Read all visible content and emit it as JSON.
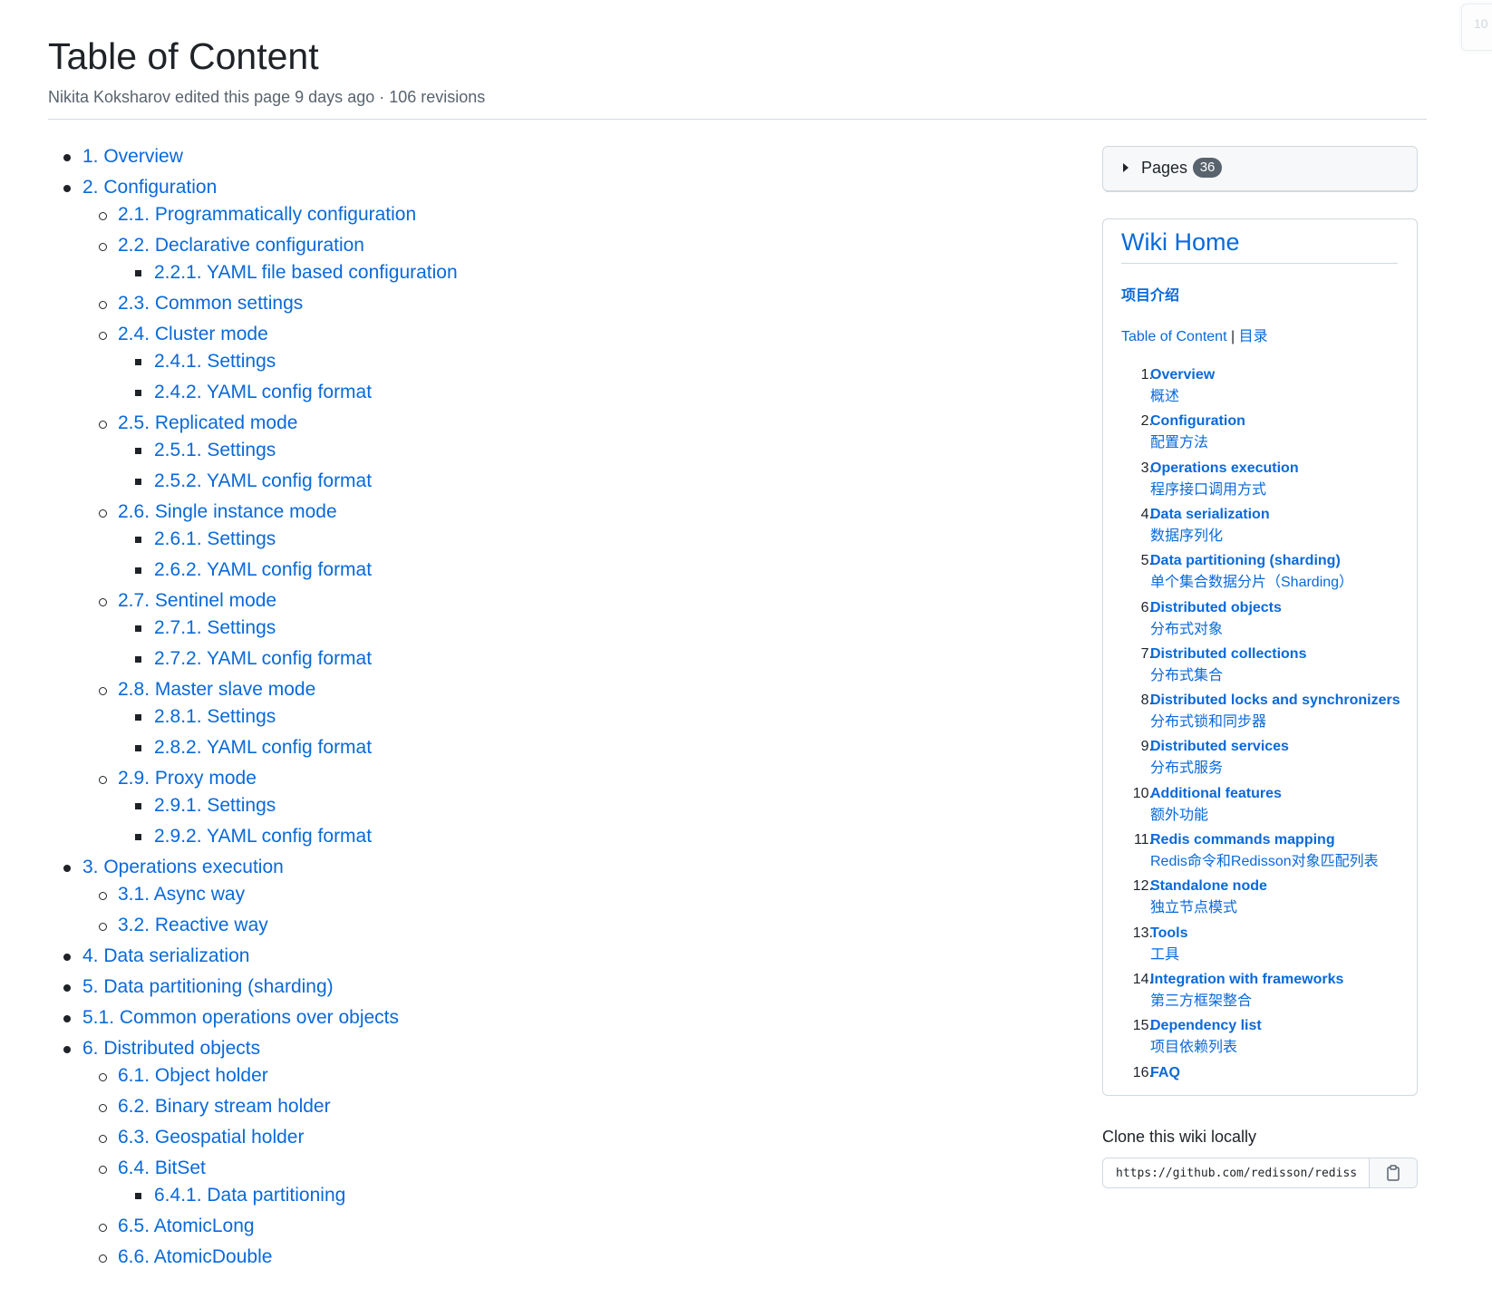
{
  "corner": {
    "text": "10"
  },
  "header": {
    "title": "Table of Content",
    "meta": "Nikita Koksharov edited this page 9 days ago · 106 revisions"
  },
  "toc": [
    {
      "level": 1,
      "label": "1. Overview"
    },
    {
      "level": 1,
      "label": "2. Configuration"
    },
    {
      "level": 2,
      "label": "2.1. Programmatically configuration"
    },
    {
      "level": 2,
      "label": "2.2. Declarative configuration"
    },
    {
      "level": 3,
      "label": "2.2.1. YAML file based configuration"
    },
    {
      "level": 2,
      "label": "2.3. Common settings"
    },
    {
      "level": 2,
      "label": "2.4. Cluster mode"
    },
    {
      "level": 3,
      "label": "2.4.1. Settings"
    },
    {
      "level": 3,
      "label": "2.4.2. YAML config format"
    },
    {
      "level": 2,
      "label": "2.5. Replicated mode"
    },
    {
      "level": 3,
      "label": "2.5.1. Settings"
    },
    {
      "level": 3,
      "label": "2.5.2. YAML config format"
    },
    {
      "level": 2,
      "label": "2.6. Single instance mode"
    },
    {
      "level": 3,
      "label": "2.6.1. Settings"
    },
    {
      "level": 3,
      "label": "2.6.2. YAML config format"
    },
    {
      "level": 2,
      "label": "2.7. Sentinel mode"
    },
    {
      "level": 3,
      "label": "2.7.1. Settings"
    },
    {
      "level": 3,
      "label": "2.7.2. YAML config format"
    },
    {
      "level": 2,
      "label": "2.8. Master slave mode"
    },
    {
      "level": 3,
      "label": "2.8.1. Settings"
    },
    {
      "level": 3,
      "label": "2.8.2. YAML config format"
    },
    {
      "level": 2,
      "label": "2.9. Proxy mode"
    },
    {
      "level": 3,
      "label": "2.9.1. Settings"
    },
    {
      "level": 3,
      "label": "2.9.2. YAML config format"
    },
    {
      "level": 1,
      "label": "3. Operations execution"
    },
    {
      "level": 2,
      "label": "3.1. Async way"
    },
    {
      "level": 2,
      "label": "3.2. Reactive way"
    },
    {
      "level": 1,
      "label": "4. Data serialization"
    },
    {
      "level": 1,
      "label": "5. Data partitioning (sharding)"
    },
    {
      "level": 1,
      "label": "5.1. Common operations over objects"
    },
    {
      "level": 1,
      "label": "6. Distributed objects"
    },
    {
      "level": 2,
      "label": "6.1. Object holder"
    },
    {
      "level": 2,
      "label": "6.2. Binary stream holder"
    },
    {
      "level": 2,
      "label": "6.3. Geospatial holder"
    },
    {
      "level": 2,
      "label": "6.4. BitSet"
    },
    {
      "level": 3,
      "label": "6.4.1. Data partitioning"
    },
    {
      "level": 2,
      "label": "6.5. AtomicLong"
    },
    {
      "level": 2,
      "label": "6.6. AtomicDouble"
    }
  ],
  "sidebar": {
    "pages_label": "Pages",
    "pages_count": "36",
    "wiki_home": "Wiki Home",
    "intro": "项目介绍",
    "toc_link": "Table of Content",
    "toc_separator": " | ",
    "toc_link_zh": "目录",
    "items": [
      {
        "num": "1.",
        "en": "Overview",
        "zh": "概述"
      },
      {
        "num": "2.",
        "en": "Configuration",
        "zh": "配置方法"
      },
      {
        "num": "3.",
        "en": "Operations execution",
        "zh": "程序接口调用方式"
      },
      {
        "num": "4.",
        "en": "Data serialization",
        "zh": "数据序列化"
      },
      {
        "num": "5.",
        "en": "Data partitioning (sharding)",
        "zh": "单个集合数据分片（Sharding）"
      },
      {
        "num": "6.",
        "en": "Distributed objects",
        "zh": "分布式对象"
      },
      {
        "num": "7.",
        "en": "Distributed collections",
        "zh": "分布式集合"
      },
      {
        "num": "8.",
        "en": "Distributed locks and synchronizers",
        "zh": "分布式锁和同步器"
      },
      {
        "num": "9.",
        "en": "Distributed services",
        "zh": "分布式服务"
      },
      {
        "num": "10.",
        "en": "Additional features",
        "zh": "额外功能"
      },
      {
        "num": "11.",
        "en": "Redis commands mapping",
        "zh": "Redis命令和Redisson对象匹配列表"
      },
      {
        "num": "12.",
        "en": "Standalone node",
        "zh": "独立节点模式"
      },
      {
        "num": "13.",
        "en": "Tools",
        "zh": "工具"
      },
      {
        "num": "14.",
        "en": "Integration with frameworks",
        "zh": "第三方框架整合"
      },
      {
        "num": "15.",
        "en": "Dependency list",
        "zh": "项目依赖列表"
      },
      {
        "num": "16.",
        "en": "FAQ",
        "zh": ""
      }
    ],
    "clone_title": "Clone this wiki locally",
    "clone_url": "https://github.com/redisson/redisson.wiki.git"
  }
}
